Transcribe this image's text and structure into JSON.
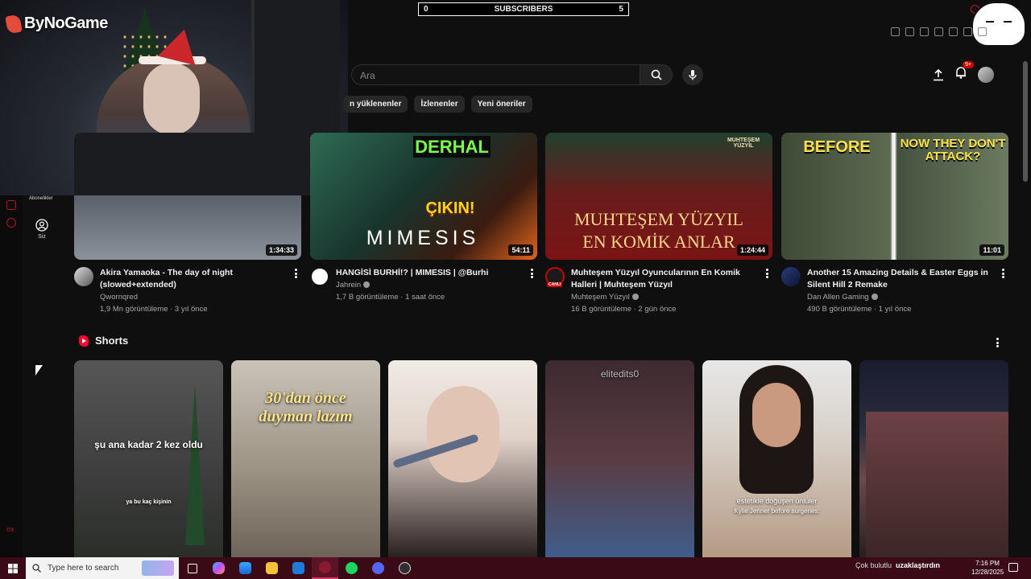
{
  "overlay": {
    "brand": "ByNoGame",
    "subscribers_label": "SUBSCRIBERS",
    "subscribers_left": "0",
    "subscribers_right": "5"
  },
  "header": {
    "search_placeholder": "Ara",
    "notification_badge": "9+",
    "icons": [
      "upload-icon",
      "bell-icon",
      "avatar"
    ]
  },
  "chips": [
    "n yüklenenler",
    "İzlenenler",
    "Yeni öneriler"
  ],
  "sidebar": {
    "subscriptions_label": "Abonelikler",
    "you_label": "Siz"
  },
  "videos": [
    {
      "title": "Akira Yamaoka - The day of night (slowed+extended)",
      "channel": "Qwornqred",
      "verified": false,
      "stats": "1,9 Mn görüntüleme · 3 yıl önce",
      "duration": "1:34:33",
      "live_badge": ""
    },
    {
      "title": "HANGİSİ BURHİ!? | MIMESIS | @Burhi",
      "channel": "Jahrein",
      "verified": true,
      "stats": "1,7 B görüntüleme · 1 saat önce",
      "duration": "54:11",
      "overlay_top": "DERHAL",
      "overlay_mid": "ÇIKIN!",
      "overlay_bottom": "MIMESIS",
      "live_badge": ""
    },
    {
      "title": "Muhteşem Yüzyıl Oyuncularının En Komik Halleri | Muhteşem Yüzyıl",
      "channel": "Muhteşem Yüzyıl",
      "verified": true,
      "stats": "16 B görüntüleme · 2 gün önce",
      "duration": "1:24:44",
      "overlay_corner": "MUHTEŞEM YÜZYIL",
      "overlay_line1": "MUHTEŞEM YÜZYIL",
      "overlay_line2": "EN KOMİK ANLAR",
      "live_badge": "CANLI"
    },
    {
      "title": "Another 15 Amazing Details & Easter Eggs in Silent Hill 2 Remake",
      "channel": "Dan Allen Gaming",
      "verified": true,
      "stats": "490 B görüntüleme · 1 yıl önce",
      "duration": "11:01",
      "overlay_left": "BEFORE",
      "overlay_right": "NOW THEY DON'T ATTACK?",
      "live_badge": ""
    }
  ],
  "shorts": {
    "heading": "Shorts",
    "items": [
      {
        "caption": "şu ana kadar 2 kez oldu",
        "sub_caption": "ya bu kaç kişinin"
      },
      {
        "caption": "30'dan önce duyman lazım",
        "sub_caption": ""
      },
      {
        "caption": "",
        "sub_caption": ""
      },
      {
        "caption": "elitedits0",
        "sub_caption": ""
      },
      {
        "caption": "estetikle doğuşen ünlüler",
        "sub_caption": "Kylie Jenner before surgeries:"
      },
      {
        "caption": "",
        "sub_caption": ""
      }
    ]
  },
  "taskbar": {
    "search_placeholder": "Type here to search",
    "weather": "Çok bulutlu",
    "weather_extra": "uzaklaştırdın",
    "time": "7:16 PM",
    "date": "12/28/2025"
  },
  "colors": {
    "background": "#0f0f0f",
    "accent_red": "#ff0033",
    "taskbar": "#3a0b17"
  }
}
